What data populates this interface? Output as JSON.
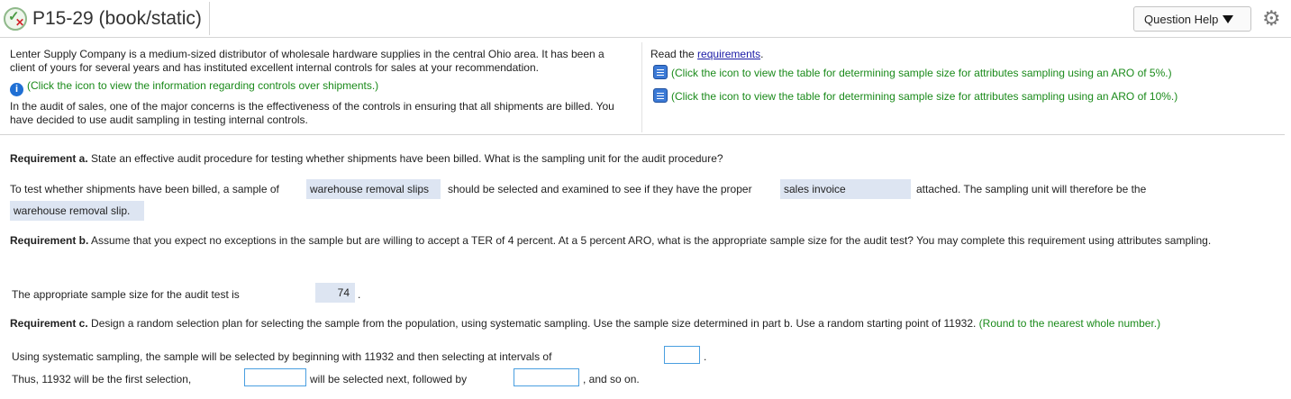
{
  "header": {
    "title": "P15-29 (book/static)",
    "question_help": "Question Help",
    "icons": {
      "status": "check-x-icon",
      "settings": "gear-icon"
    }
  },
  "intro": {
    "p1": "Lenter Supply Company is a medium-sized distributor of wholesale hardware supplies in the central Ohio area. It has been a client of yours for several years and has instituted excellent internal controls for sales at your recommendation.",
    "info_link": "(Click the icon to view the information regarding controls over shipments.)",
    "p2": "In the audit of sales, one of the major concerns is the effectiveness of the controls in ensuring that all shipments are billed. You have decided to use audit sampling in testing internal controls."
  },
  "right_panel": {
    "read_prefix": "Read the ",
    "requirements_link": "requirements",
    "read_suffix": ".",
    "table5": "(Click the icon to view the table for determining sample size for attributes sampling using an ARO of 5%.)",
    "table10": "(Click the icon to view the table for determining sample size for attributes sampling using an ARO of 10%.)"
  },
  "req_a": {
    "label": "Requirement a.",
    "text": " State an effective audit procedure for testing whether shipments have been billed. What is the sampling unit for the audit procedure?",
    "s1": "To test whether shipments have been billed, a sample of",
    "ans1": "warehouse removal slips",
    "s2": "should be selected and examined to see if they have the proper",
    "ans2": "sales invoice",
    "s3": "attached. The sampling unit will therefore be the",
    "ans3": "warehouse removal slip."
  },
  "req_b": {
    "label": "Requirement b.",
    "text": " Assume that you expect no exceptions in the sample but are willing to accept a TER of 4 percent. At a 5 percent ARO, what is the appropriate sample size for the audit test? You may complete this requirement using attributes sampling.",
    "prompt": "The appropriate sample size for the audit test is",
    "answer": "74",
    "suffix": "."
  },
  "req_c": {
    "label": "Requirement c.",
    "text": " Design a random selection plan for selecting the sample from the population, using systematic sampling. Use the sample size determined in part b. Use a random starting point of 11932.",
    "note": " (Round to the nearest whole number.)",
    "line1": "Using systematic sampling, the sample will be selected by beginning with 11932 and then selecting at intervals of",
    "line1_suffix": ".",
    "line2_a": "Thus, 11932 will be the first selection,",
    "line2_b": "will be selected next, followed by",
    "line2_c": ", and so on.",
    "inputs": {
      "interval": "",
      "next": "",
      "following": ""
    }
  }
}
